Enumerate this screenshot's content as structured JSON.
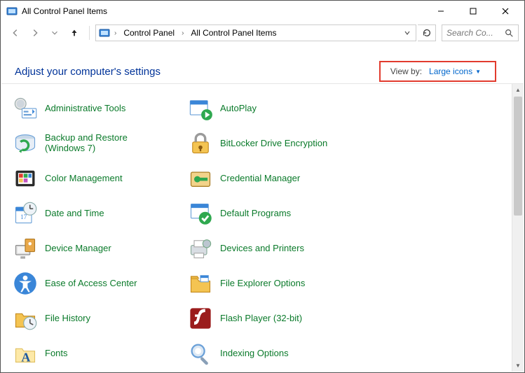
{
  "window": {
    "title": "All Control Panel Items"
  },
  "breadcrumb": {
    "root": "Control Panel",
    "leaf": "All Control Panel Items"
  },
  "search": {
    "placeholder": "Search Co..."
  },
  "header": {
    "title": "Adjust your computer's settings",
    "viewby_label": "View by:",
    "viewby_value": "Large icons"
  },
  "items": {
    "c0r0": "Administrative Tools",
    "c1r0": "AutoPlay",
    "c0r1": "Backup and Restore (Windows 7)",
    "c1r1": "BitLocker Drive Encryption",
    "c0r2": "Color Management",
    "c1r2": "Credential Manager",
    "c0r3": "Date and Time",
    "c1r3": "Default Programs",
    "c0r4": "Device Manager",
    "c1r4": "Devices and Printers",
    "c0r5": "Ease of Access Center",
    "c1r5": "File Explorer Options",
    "c0r6": "File History",
    "c1r6": "Flash Player (32-bit)",
    "c0r7": "Fonts",
    "c1r7": "Indexing Options"
  }
}
